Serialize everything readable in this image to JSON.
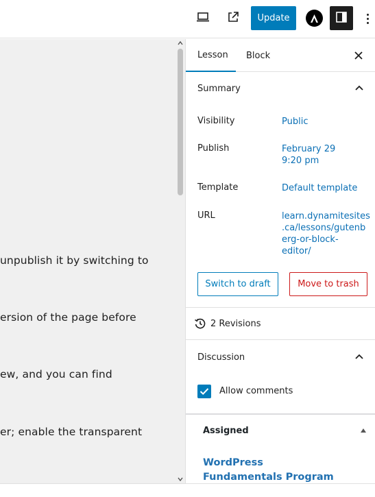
{
  "toolbar": {
    "preview_icon": "laptop-icon",
    "view_post_icon": "external-link-icon",
    "update_label": "Update",
    "logo_icon": "astra-logo-icon",
    "settings_icon": "sidebar-toggle-icon",
    "more_icon": "vertical-ellipsis-icon"
  },
  "content": {
    "lines": [
      "unpublish it by switching to",
      "ersion of the page before",
      "ew, and you can find",
      "er; enable the transparent"
    ]
  },
  "sidebar": {
    "tabs": [
      {
        "label": "Lesson",
        "active": true
      },
      {
        "label": "Block",
        "active": false
      }
    ],
    "close_icon": "close-icon",
    "summary": {
      "title": "Summary",
      "rows": [
        {
          "label": "Visibility",
          "value": "Public"
        },
        {
          "label": "Publish",
          "value_line1": "February 29",
          "value_line2": "9:20 pm"
        },
        {
          "label": "Template",
          "value": "Default template"
        },
        {
          "label": "URL",
          "value_lines": [
            "learn.dynamitesites",
            ".ca/lessons/gutenb",
            "erg-or-block-",
            "editor/"
          ]
        }
      ],
      "switch_to_draft": "Switch to draft",
      "move_to_trash": "Move to trash"
    },
    "revisions": {
      "icon": "history-icon",
      "label": "2 Revisions"
    },
    "discussion": {
      "title": "Discussion",
      "allow_comments_label": "Allow comments",
      "allow_comments_checked": true
    },
    "assigned": {
      "title": "Assigned",
      "link_label": "WordPress Fundamentals Program"
    }
  },
  "colors": {
    "accent": "#007cba",
    "danger": "#cc1818",
    "link": "#0a6fb5",
    "content_bg": "#f0f0f0"
  }
}
